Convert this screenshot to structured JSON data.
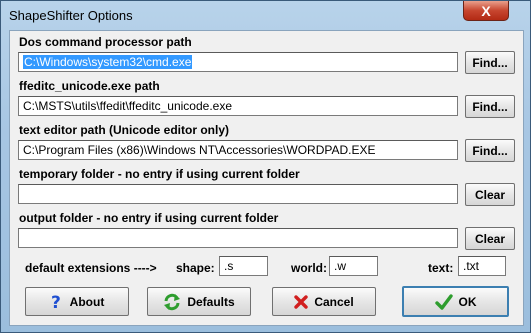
{
  "window": {
    "title": "ShapeShifter Options",
    "close_symbol": "X"
  },
  "dos": {
    "label": "Dos command processor path",
    "value": "C:\\Windows\\system32\\cmd.exe",
    "find_label": "Find..."
  },
  "ffeditc": {
    "label": "ffeditc_unicode.exe path",
    "value": "C:\\MSTS\\utils\\ffedit\\ffeditc_unicode.exe",
    "find_label": "Find..."
  },
  "editor": {
    "label": "text editor path  (Unicode editor only)",
    "value": "C:\\Program Files (x86)\\Windows NT\\Accessories\\WORDPAD.EXE",
    "find_label": "Find..."
  },
  "temp": {
    "label": "temporary folder - no entry if using current folder",
    "value": "",
    "clear_label": "Clear"
  },
  "output": {
    "label": "output folder - no entry if using current folder",
    "value": "",
    "clear_label": "Clear"
  },
  "extensions": {
    "label": "default extensions ---->",
    "shape_label": "shape:",
    "shape_value": ".s",
    "world_label": "world:",
    "world_value": ".w",
    "text_label": "text:",
    "text_value": ".txt"
  },
  "buttons": {
    "about": "About",
    "defaults": "Defaults",
    "cancel": "Cancel",
    "ok": "OK"
  },
  "icons": {
    "about": "help-question-icon",
    "defaults": "refresh-icon",
    "cancel": "cancel-x-icon",
    "ok": "checkmark-icon"
  },
  "colors": {
    "about_icon": "#1f4fd1",
    "defaults_icon": "#2e9d2e",
    "cancel_icon": "#d11f1f",
    "ok_icon": "#2e9d2e",
    "selection": "#3399ff"
  }
}
